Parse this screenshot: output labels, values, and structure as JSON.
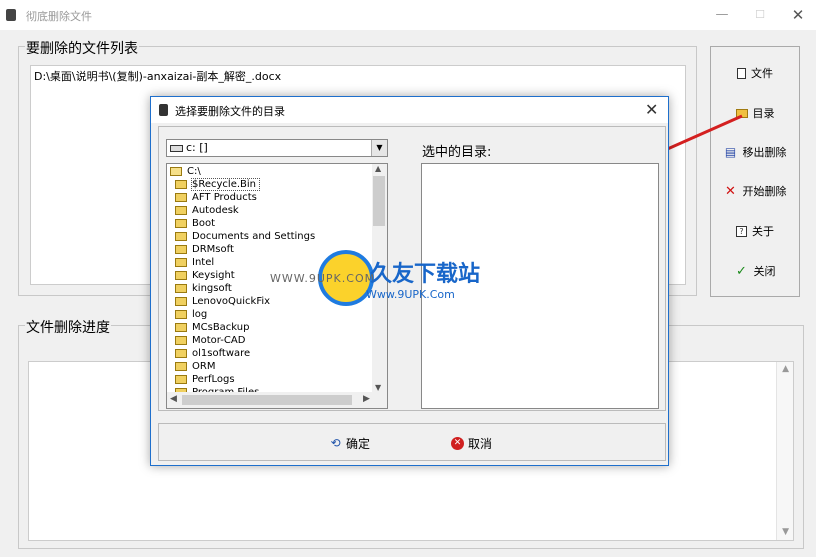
{
  "window": {
    "title": "彻底删除文件",
    "controls": {
      "minimize": "—",
      "maximize": "☐",
      "close": "✕"
    }
  },
  "file_group": {
    "label": "要删除的文件列表",
    "items": [
      "D:\\桌面\\说明书\\(复制)-anxaizai-副本_解密_.docx"
    ]
  },
  "progress_group": {
    "label": "文件删除进度"
  },
  "side_buttons": {
    "file": "文件",
    "directory": "目录",
    "remove": "移出删除",
    "start": "开始删除",
    "about": "关于",
    "close": "关闭"
  },
  "dialog": {
    "title": "选择要删除文件的目录",
    "close": "✕",
    "drive": "c: []",
    "root": "C:\\",
    "folders": [
      "$Recycle.Bin",
      "AFT Products",
      "Autodesk",
      "Boot",
      "Documents and Settings",
      "DRMsoft",
      "Intel",
      "Keysight",
      "kingsoft",
      "LenovoQuickFix",
      "log",
      "MCsBackup",
      "Motor-CAD",
      "ol1software",
      "ORM",
      "PerfLogs",
      "Program Files"
    ],
    "selected_label": "选中的目录:",
    "ok": "确定",
    "cancel": "取消"
  },
  "watermark": {
    "left": "WWW.9UPK.COM",
    "big": "久友下载站",
    "url": "Www.9UPK.Com"
  },
  "colors": {
    "accent": "#1e6fcc",
    "arrow": "#d42020",
    "watermark": "#1866c9"
  }
}
